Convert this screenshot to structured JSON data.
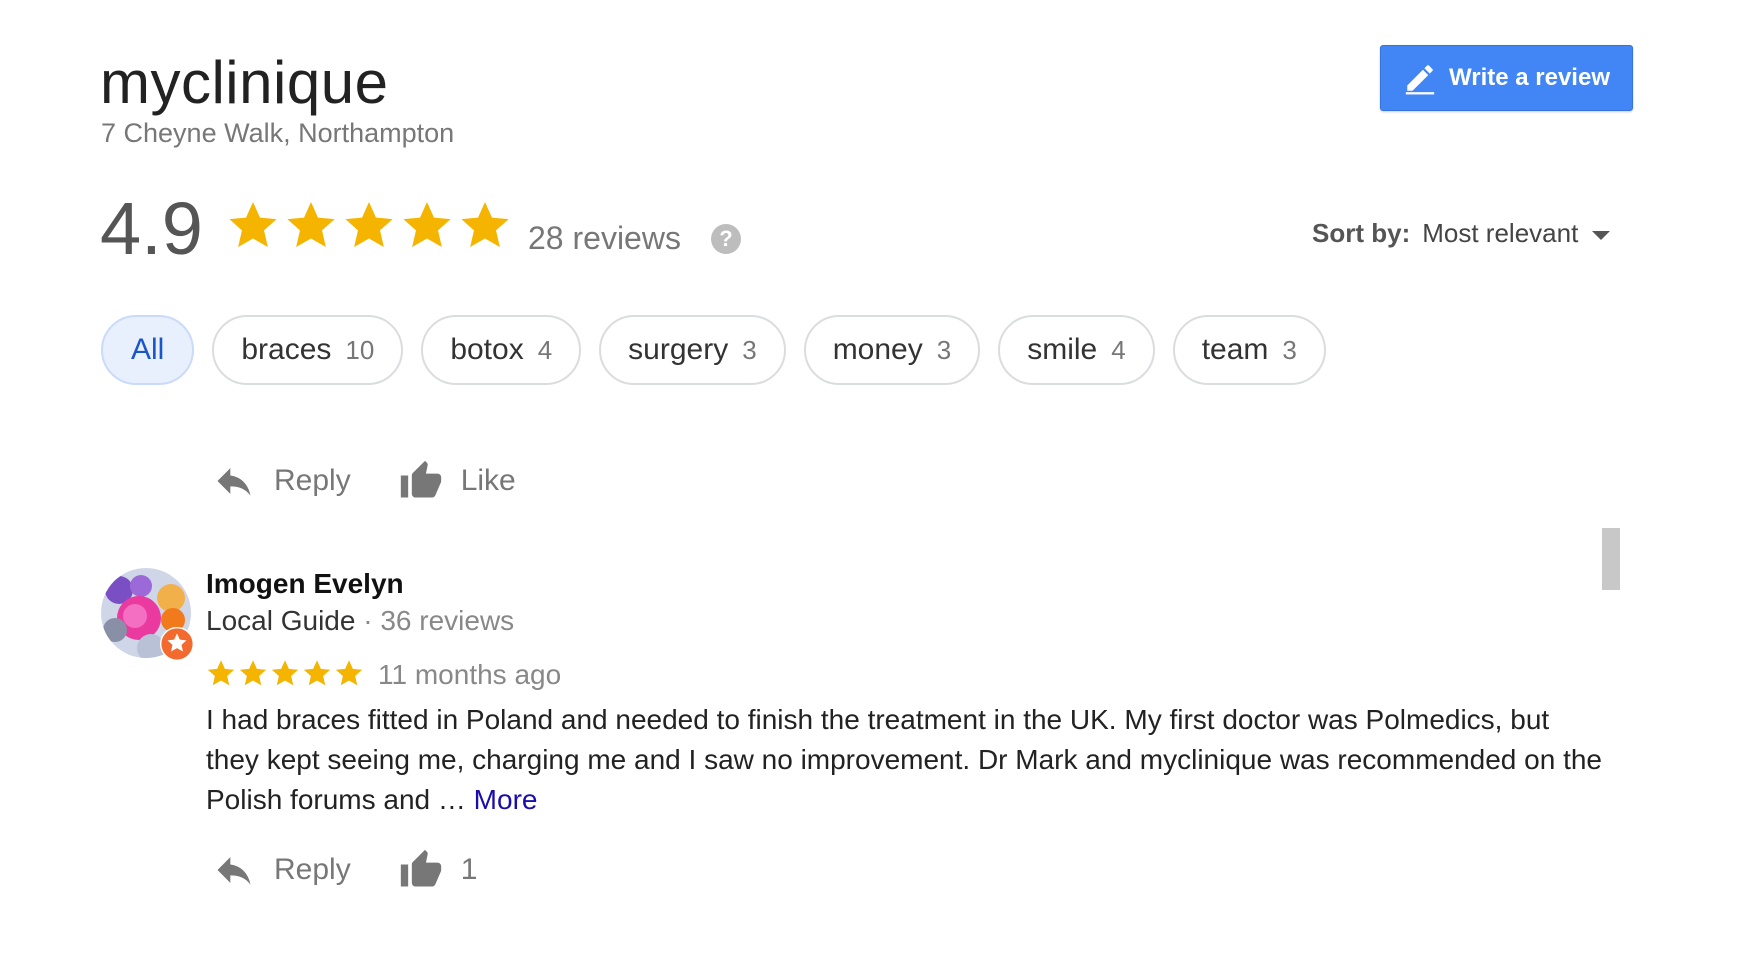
{
  "business": {
    "name": "myclinique",
    "address": "7 Cheyne Walk, Northampton",
    "write_review_label": "Write a review"
  },
  "rating": {
    "value": "4.9",
    "stars": 5,
    "reviews_label": "28 reviews",
    "help_symbol": "?"
  },
  "sort": {
    "label": "Sort by:",
    "value": "Most relevant"
  },
  "chips": [
    {
      "label": "All",
      "count": ""
    },
    {
      "label": "braces",
      "count": "10"
    },
    {
      "label": "botox",
      "count": "4"
    },
    {
      "label": "surgery",
      "count": "3"
    },
    {
      "label": "money",
      "count": "3"
    },
    {
      "label": "smile",
      "count": "4"
    },
    {
      "label": "team",
      "count": "3"
    }
  ],
  "previous_review_actions": {
    "reply_label": "Reply",
    "like_label": "Like"
  },
  "review": {
    "name": "Imogen Evelyn",
    "guide_label": "Local Guide",
    "separator": "·",
    "reviewer_count": "36 reviews",
    "stars": 5,
    "date": "11 months ago",
    "text": "I had braces fitted in Poland and needed to finish the treatment in the UK. My first doctor was Polmedics, but they kept seeing me, charging me and I saw no improvement. Dr Mark and myclinique was recommended on the Polish forums and … ",
    "more_label": "More",
    "reply_label": "Reply",
    "like_count": "1"
  },
  "colors": {
    "accent": "#4285f4",
    "star": "#f4b400",
    "link": "#1a0dab",
    "chip_active_bg": "#e8f0fe"
  },
  "icons": [
    "pencil-icon",
    "star-icon",
    "help-icon",
    "caret-down-icon",
    "reply-icon",
    "thumbs-up-icon",
    "local-guide-badge-icon"
  ]
}
